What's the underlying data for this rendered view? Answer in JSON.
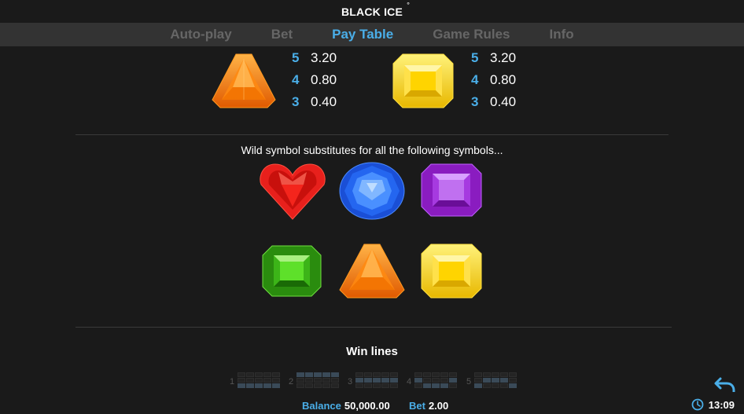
{
  "header": {
    "title": "BLACK ICE",
    "title_mark": "°"
  },
  "tabs": [
    {
      "label": "Auto-play",
      "active": false
    },
    {
      "label": "Bet",
      "active": false
    },
    {
      "label": "Pay Table",
      "active": true
    },
    {
      "label": "Game Rules",
      "active": false
    },
    {
      "label": "Info",
      "active": false
    }
  ],
  "paytable": [
    {
      "symbol": "orange-triangle-gem-icon",
      "pays": [
        {
          "count": "5",
          "value": "3.20"
        },
        {
          "count": "4",
          "value": "0.80"
        },
        {
          "count": "3",
          "value": "0.40"
        }
      ]
    },
    {
      "symbol": "yellow-square-gem-icon",
      "pays": [
        {
          "count": "5",
          "value": "3.20"
        },
        {
          "count": "4",
          "value": "0.80"
        },
        {
          "count": "3",
          "value": "0.40"
        }
      ]
    }
  ],
  "wild": {
    "text": "Wild symbol substitutes for all the following symbols...",
    "symbols": [
      "red-heart-gem-icon",
      "blue-round-gem-icon",
      "purple-square-gem-icon",
      "green-emerald-gem-icon",
      "orange-triangle-gem-icon",
      "yellow-square-gem-icon"
    ]
  },
  "win_lines": {
    "title": "Win lines",
    "lines": [
      {
        "number": "1",
        "pattern": [
          [
            0,
            0,
            0,
            0,
            0
          ],
          [
            0,
            0,
            0,
            0,
            0
          ],
          [
            1,
            1,
            1,
            1,
            1
          ]
        ]
      },
      {
        "number": "2",
        "pattern": [
          [
            1,
            1,
            1,
            1,
            1
          ],
          [
            0,
            0,
            0,
            0,
            0
          ],
          [
            0,
            0,
            0,
            0,
            0
          ]
        ]
      },
      {
        "number": "3",
        "pattern": [
          [
            0,
            0,
            0,
            0,
            0
          ],
          [
            1,
            1,
            1,
            1,
            1
          ],
          [
            0,
            0,
            0,
            0,
            0
          ]
        ]
      },
      {
        "number": "4",
        "pattern": [
          [
            0,
            0,
            0,
            0,
            0
          ],
          [
            1,
            0,
            0,
            0,
            1
          ],
          [
            0,
            1,
            1,
            1,
            0
          ]
        ]
      },
      {
        "number": "5",
        "pattern": [
          [
            0,
            0,
            0,
            0,
            0
          ],
          [
            0,
            1,
            1,
            1,
            0
          ],
          [
            1,
            0,
            0,
            0,
            1
          ]
        ]
      }
    ]
  },
  "footer": {
    "balance_label": "Balance",
    "balance_value": "50,000.00",
    "bet_label": "Bet",
    "bet_value": "2.00",
    "time": "13:09"
  },
  "colors": {
    "accent": "#4aaee8",
    "tab_inactive": "#666666",
    "background": "#1a1a1a",
    "tab_bar": "#333333"
  }
}
